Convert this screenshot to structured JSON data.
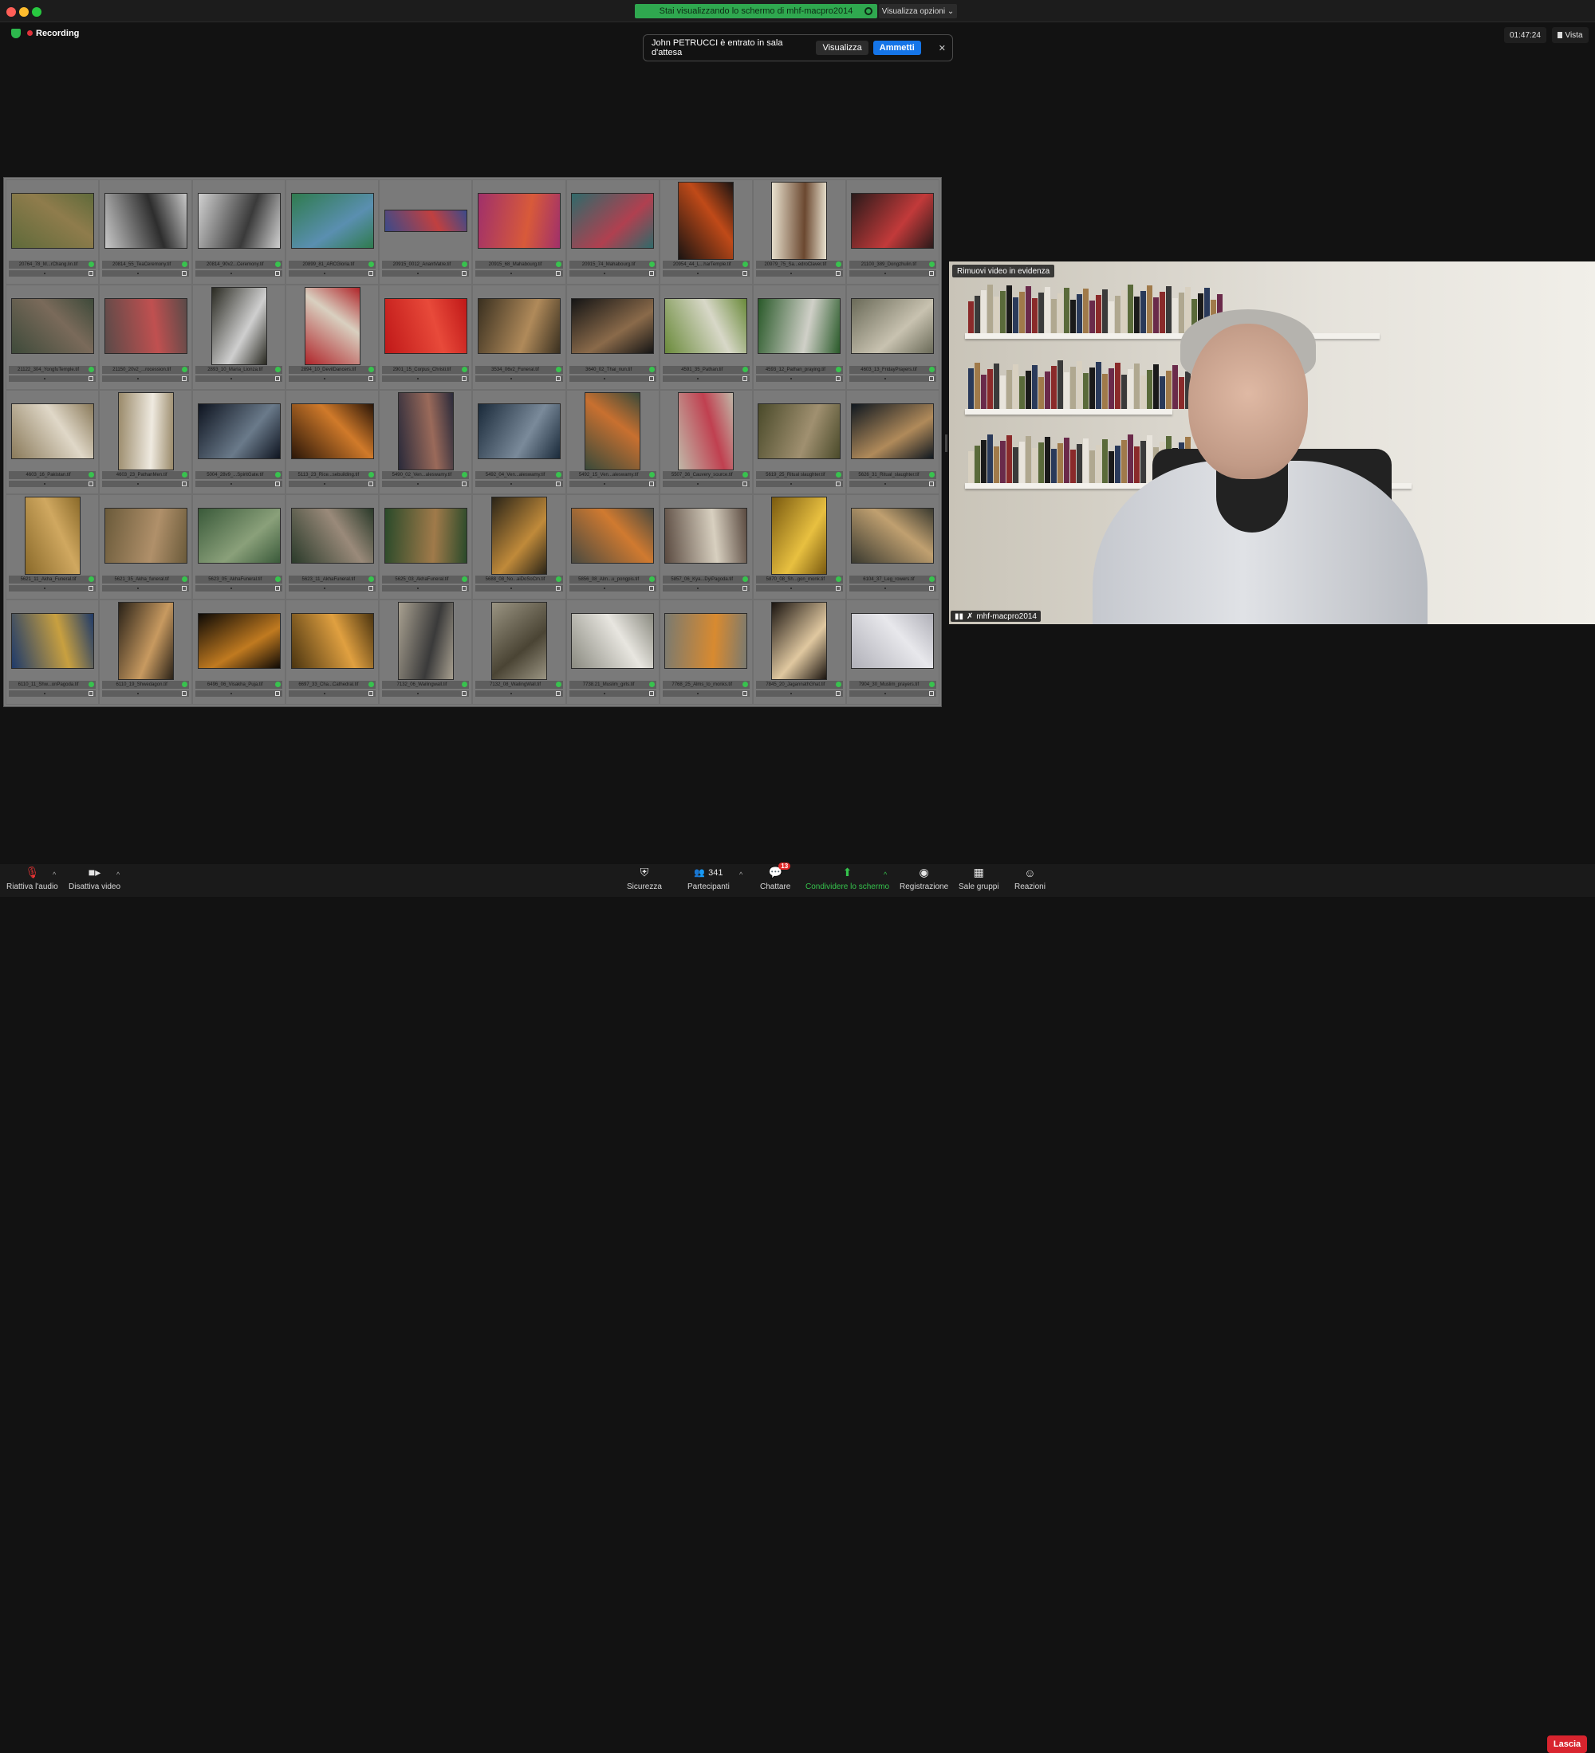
{
  "window": {
    "share_banner": "Stai visualizzando lo schermo di mhf-macpro2014",
    "view_options": "Visualizza opzioni ⌄"
  },
  "recording": {
    "label": "Recording"
  },
  "notification": {
    "message": "John PETRUCCI è entrato in sala d'attesa",
    "view_label": "Visualizza",
    "admit_label": "Ammetti",
    "close_icon": "✕"
  },
  "timer": "01:47:24",
  "view_button": "Vista",
  "thumbnails": [
    {
      "file": "20764_78_M...rChang.lin.tif",
      "colors": [
        "#5f6a3a",
        "#8f7c4c"
      ],
      "shape": "landscape"
    },
    {
      "file": "20814_55_TeaCeremony.tif",
      "colors": [
        "#c8c8c8",
        "#2d2d2d"
      ],
      "shape": "landscape"
    },
    {
      "file": "20814_90v2...Ceremony.tif",
      "colors": [
        "#d0d0d0",
        "#3a3a3a"
      ],
      "shape": "landscape"
    },
    {
      "file": "20899_81_ARCGloria.tif",
      "colors": [
        "#2f7b4e",
        "#5a8fb0"
      ],
      "shape": "landscape"
    },
    {
      "file": "20915_0012_AnantVatre.tif",
      "colors": [
        "#3b4a8a",
        "#c04040"
      ],
      "shape": "panorama"
    },
    {
      "file": "20915_68_Mahabourg.tif",
      "colors": [
        "#a0306a",
        "#d85a3a"
      ],
      "shape": "landscape"
    },
    {
      "file": "20915_74_Mahabourg.tif",
      "colors": [
        "#2f6a6a",
        "#b04050"
      ],
      "shape": "landscape"
    },
    {
      "file": "20954_44_L...harTemple.tif",
      "colors": [
        "#1a1412",
        "#c04a18"
      ],
      "shape": "portrait"
    },
    {
      "file": "20979_75_Sa...edroClaver.tif",
      "colors": [
        "#e9e2cf",
        "#6b4830"
      ],
      "shape": "portrait"
    },
    {
      "file": "21100_389_Dongzhulin.tif",
      "colors": [
        "#2a1a1a",
        "#c23a3a"
      ],
      "shape": "landscape"
    },
    {
      "file": "21122_304_YongfuTemple.tif",
      "colors": [
        "#3e4a3a",
        "#7a6a5a"
      ],
      "shape": "landscape"
    },
    {
      "file": "21150_20v2_...rocession.tif",
      "colors": [
        "#5a4a48",
        "#c05050"
      ],
      "shape": "landscape"
    },
    {
      "file": "2893_10_Maria_Lionza.tif",
      "colors": [
        "#2a2a22",
        "#cfcfcf"
      ],
      "shape": "portrait"
    },
    {
      "file": "2894_10_DevilDancers.tif",
      "colors": [
        "#b0252a",
        "#d9d0c0"
      ],
      "shape": "portrait"
    },
    {
      "file": "2901_15_Corpus_Christi.tif",
      "colors": [
        "#c01818",
        "#e84a3a"
      ],
      "shape": "landscape"
    },
    {
      "file": "3534_06v2_Funeral.tif",
      "colors": [
        "#3a3020",
        "#b08a5a"
      ],
      "shape": "landscape"
    },
    {
      "file": "3640_02_Thai_nun.tif",
      "colors": [
        "#151515",
        "#8a6a4a"
      ],
      "shape": "landscape"
    },
    {
      "file": "4591_35_Pathan.tif",
      "colors": [
        "#6a8a3a",
        "#d8d8c8"
      ],
      "shape": "landscape"
    },
    {
      "file": "4593_12_Pathan_praying.tif",
      "colors": [
        "#2a5a2a",
        "#d0d0c8"
      ],
      "shape": "landscape"
    },
    {
      "file": "4603_13_FridayPrayers.tif",
      "colors": [
        "#6a6a58",
        "#c8c2b0"
      ],
      "shape": "landscape"
    },
    {
      "file": "4603_16_Pakistan.tif",
      "colors": [
        "#8a7a5a",
        "#e0d8c8"
      ],
      "shape": "landscape"
    },
    {
      "file": "4603_23_PathanMen.tif",
      "colors": [
        "#9a8a6a",
        "#efeae0"
      ],
      "shape": "portrait"
    },
    {
      "file": "5004_28v9_...SpiritGate.tif",
      "colors": [
        "#0e1420",
        "#6a7a8a"
      ],
      "shape": "landscape"
    },
    {
      "file": "5113_23_Rice...sebuilding.tif",
      "colors": [
        "#2a1608",
        "#d07a2a"
      ],
      "shape": "landscape"
    },
    {
      "file": "5490_02_Ven...aleswamy.tif",
      "colors": [
        "#2a2a3a",
        "#9a6a5a"
      ],
      "shape": "portrait"
    },
    {
      "file": "5492_04_Ven...aleswamy.tif",
      "colors": [
        "#1a2a3a",
        "#7a8a9a"
      ],
      "shape": "landscape"
    },
    {
      "file": "5492_15_Ven...aleswamy.tif",
      "colors": [
        "#3a4a3a",
        "#c87030"
      ],
      "shape": "portrait"
    },
    {
      "file": "5507_36_Cauvery_source.tif",
      "colors": [
        "#c0b8a8",
        "#c04050"
      ],
      "shape": "portrait"
    },
    {
      "file": "5619_25_Ritual slaughter.tif",
      "colors": [
        "#4a4a2a",
        "#a09070"
      ],
      "shape": "landscape"
    },
    {
      "file": "5626_31_Ritual_slaughter.tif",
      "colors": [
        "#101820",
        "#b08a5a"
      ],
      "shape": "landscape"
    },
    {
      "file": "5621_11_Akha_Funeral.tif",
      "colors": [
        "#8a6a2a",
        "#d0a860"
      ],
      "shape": "portrait"
    },
    {
      "file": "5621_35_Akha_funeral.tif",
      "colors": [
        "#6a5a3a",
        "#b0906a"
      ],
      "shape": "landscape"
    },
    {
      "file": "5623_05_AkhaFuneral.tif",
      "colors": [
        "#3a5a3a",
        "#8aa07a"
      ],
      "shape": "landscape"
    },
    {
      "file": "5623_11_AkhaFuneral.tif",
      "colors": [
        "#2a3a2a",
        "#9a8a7a"
      ],
      "shape": "landscape"
    },
    {
      "file": "5625_03_AkhaFuneral.tif",
      "colors": [
        "#2a4a2a",
        "#a07a4a"
      ],
      "shape": "landscape"
    },
    {
      "file": "5688_08_No...aiDoSoCm.tif",
      "colors": [
        "#2a2418",
        "#c08a3a"
      ],
      "shape": "portrait"
    },
    {
      "file": "5856_08_Alm...u_pongpis.tif",
      "colors": [
        "#4a4a40",
        "#d07a30"
      ],
      "shape": "landscape"
    },
    {
      "file": "5857_06_Kya...DyiPagoda.tif",
      "colors": [
        "#5a4a40",
        "#d8d0c0"
      ],
      "shape": "landscape"
    },
    {
      "file": "5870_08_Sh...gon_monk.tif",
      "colors": [
        "#7a5a10",
        "#e8c040"
      ],
      "shape": "portrait"
    },
    {
      "file": "6104_37_Leg_rowers.tif",
      "colors": [
        "#3a3a30",
        "#c0a070"
      ],
      "shape": "landscape"
    },
    {
      "file": "6110_11_Shw...onPagoda.tif",
      "colors": [
        "#1e3a6a",
        "#c8a040"
      ],
      "shape": "landscape"
    },
    {
      "file": "6110_19_Shwedagon.tif",
      "colors": [
        "#2a2218",
        "#c89a60"
      ],
      "shape": "portrait"
    },
    {
      "file": "6496_06_Visakha_Puja.tif",
      "colors": [
        "#0e0a06",
        "#c07a20"
      ],
      "shape": "landscape"
    },
    {
      "file": "6697_33_Cha...Cathedral.tif",
      "colors": [
        "#4a3410",
        "#e0a040"
      ],
      "shape": "landscape"
    },
    {
      "file": "7132_06_Wailingwall.tif",
      "colors": [
        "#a8a090",
        "#3a3a3a"
      ],
      "shape": "portrait"
    },
    {
      "file": "7132_08_WailingWall.tif",
      "colors": [
        "#9a9482",
        "#4a4434"
      ],
      "shape": "portrait"
    },
    {
      "file": "7738.21_Muslim_girls.tif",
      "colors": [
        "#8a8a80",
        "#e8e6e0"
      ],
      "shape": "landscape"
    },
    {
      "file": "7768_25_Alms_to_monks.tif",
      "colors": [
        "#7a7a70",
        "#d88a30"
      ],
      "shape": "landscape"
    },
    {
      "file": "7845_20_JagannathGhat.tif",
      "colors": [
        "#1a1410",
        "#e0c8a0"
      ],
      "shape": "portrait"
    },
    {
      "file": "7904_30_Muslim_prayers.tif",
      "colors": [
        "#b0b0b8",
        "#e8e8ec"
      ],
      "shape": "landscape"
    }
  ],
  "video": {
    "remove_spotlight": "Rimuovi video in evidenza",
    "participant_name": "mhf-macpro2014"
  },
  "toolbar": {
    "unmute": "Riattiva l'audio",
    "stop_video": "Disattiva video",
    "security": "Sicurezza",
    "participants": "Partecipanti",
    "participant_count": "341",
    "chat": "Chattare",
    "chat_badge": "13",
    "share_screen": "Condividere lo schermo",
    "record": "Registrazione",
    "breakout": "Sale gruppi",
    "reactions": "Reazioni",
    "leave": "Lascia"
  }
}
